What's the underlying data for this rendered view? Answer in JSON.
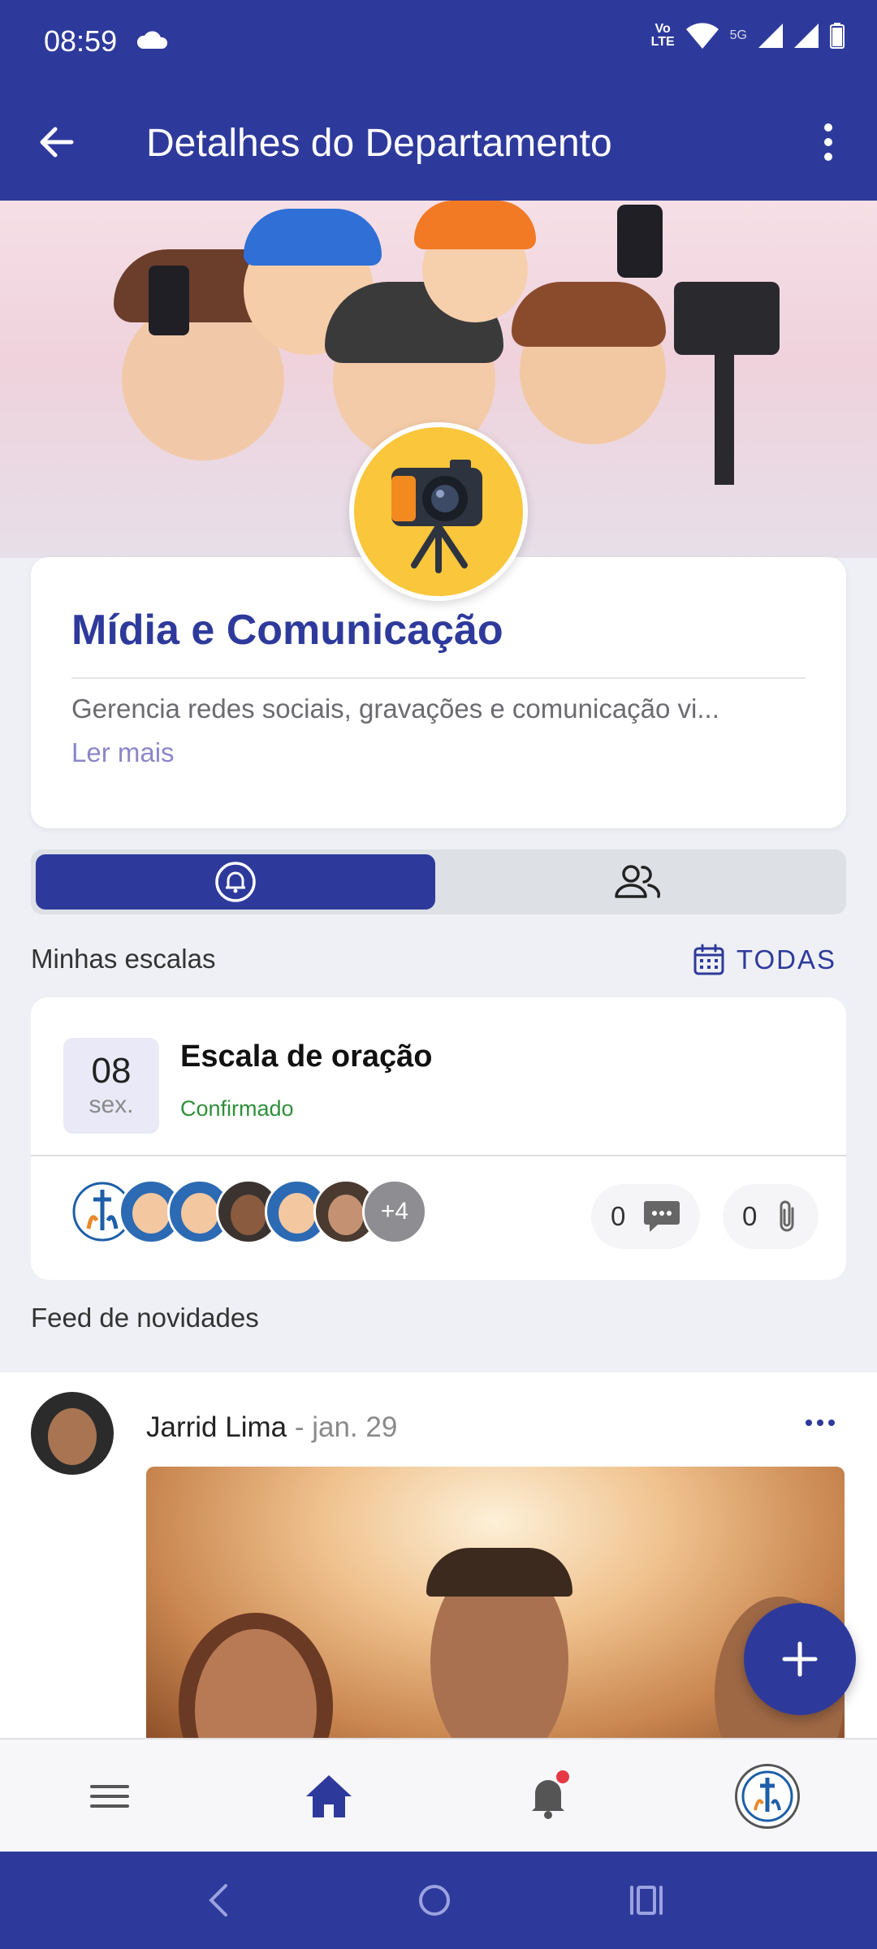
{
  "status_bar": {
    "time": "08:59",
    "network": "5G",
    "volte_top": "Vo",
    "volte_bottom": "LTE"
  },
  "app_bar": {
    "title": "Detalhes do Departamento"
  },
  "department": {
    "name": "Mídia e Comunicação",
    "description": "Gerencia redes sociais, gravações e comunicação vi...",
    "read_more": "Ler mais"
  },
  "tabs": [
    {
      "icon": "bell-icon",
      "active": true
    },
    {
      "icon": "people-icon",
      "active": false
    }
  ],
  "schedules_section": {
    "label": "Minhas escalas",
    "all_label": "TODAS"
  },
  "schedule": {
    "day": "08",
    "weekday": "sex.",
    "title": "Escala de oração",
    "status": "Confirmado",
    "extra_members": "+4",
    "comments_count": "0",
    "attachments_count": "0"
  },
  "feed_section": {
    "label": "Feed de novidades"
  },
  "post": {
    "author": "Jarrid Lima",
    "separator": " - ",
    "date": "jan. 29"
  },
  "colors": {
    "primary": "#2e3a9b",
    "status_confirmed": "#2e8f3a",
    "notification_dot": "#e53945"
  }
}
